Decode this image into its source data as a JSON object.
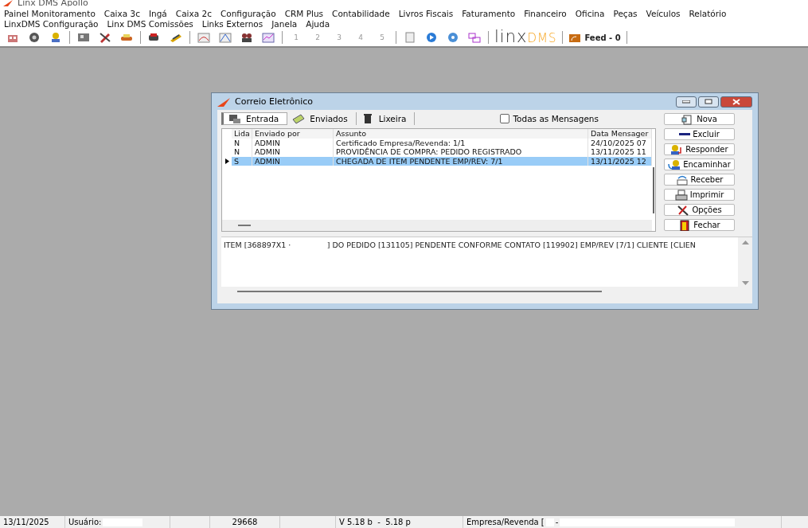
{
  "app_title": "Linx DMS Apollo",
  "menu_rows": [
    [
      "Painel Monitoramento",
      "Caixa 3c",
      "Ingá",
      "Caixa 2c",
      "Configuração",
      "CRM Plus",
      "Contabilidade",
      "Livros Fiscais",
      "Faturamento",
      "Financeiro",
      "Oficina",
      "Peças",
      "Veículos",
      "Relatório"
    ],
    [
      "LinxDMS Configuração",
      "Linx DMS Comissões",
      "Links Externos",
      "Janela",
      "Ajuda"
    ]
  ],
  "toolbar": {
    "numbers": [
      "1",
      "2",
      "3",
      "4",
      "5"
    ],
    "logo_main": "linx",
    "logo_accent": "DMS",
    "feed": "Feed - 0"
  },
  "dialog": {
    "title": "Correio Eletrônico",
    "tabs": [
      {
        "label": "Entrada",
        "selected": true,
        "kind": "inbox"
      },
      {
        "label": "Enviados",
        "selected": false,
        "kind": "sent"
      },
      {
        "label": "Lixeira",
        "selected": false,
        "kind": "trash"
      }
    ],
    "all_messages": {
      "label": "Todas as Mensagens",
      "checked": false
    },
    "table": {
      "columns": [
        "Lida",
        "Enviado por",
        "Assunto",
        "Data Mensager"
      ],
      "rows": [
        {
          "cells": [
            "N",
            "ADMIN",
            "Certificado Empresa/Revenda: 1/1",
            "24/10/2025 07"
          ],
          "selected": false
        },
        {
          "cells": [
            "N",
            "ADMIN",
            "PROVIDÊNCIA DE COMPRA: PEDIDO REGISTRADO",
            "13/11/2025 11"
          ],
          "selected": false
        },
        {
          "cells": [
            "S",
            "ADMIN",
            "CHEGADA DE ITEM PENDENTE EMP/REV: 7/1",
            "13/11/2025 12"
          ],
          "selected": true
        }
      ]
    },
    "buttons": [
      {
        "label": "Nova",
        "kind": "new"
      },
      {
        "label": "Excluir",
        "kind": "delete"
      },
      {
        "label": "Responder",
        "kind": "reply"
      },
      {
        "label": "Encaminhar",
        "kind": "forward"
      },
      {
        "label": "Receber",
        "kind": "receive"
      },
      {
        "label": "Imprimir",
        "kind": "print"
      },
      {
        "label": "Opções",
        "kind": "options"
      },
      {
        "label": "Fechar",
        "kind": "close"
      }
    ],
    "message_body": "ITEM [368897X1 ·               ] DO PEDIDO [131105] PENDENTE CONFORME CONTATO [119902] EMP/REV [7/1] CLIENTE [CLIEN"
  },
  "status_bar": {
    "date": "13/11/2025",
    "user_label": "Usuário:",
    "number": "29668",
    "version": "V 5.18 b  -  5.18 p",
    "company_label": "Empresa/Revenda [",
    "separator": "-"
  }
}
